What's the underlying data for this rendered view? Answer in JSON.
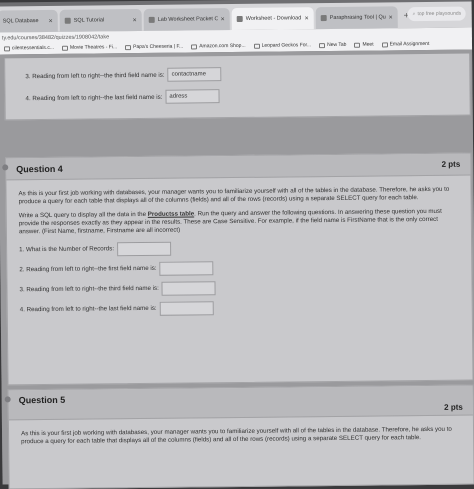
{
  "browser": {
    "tabs": [
      {
        "label": "SQL Database",
        "active": false
      },
      {
        "label": "SQL Tutorial",
        "active": false
      },
      {
        "label": "Lab Worksheet Packet Cap",
        "active": false
      },
      {
        "label": "Worksheet - Download",
        "active": true
      },
      {
        "label": "Paraphrasing Tool | Quilli",
        "active": false
      }
    ],
    "new_tab_symbol": "+",
    "search_text": "top free playsounds",
    "address": "ty.edu/courses/38482/quizzes/1908042/take",
    "bookmarks": [
      "cilentessentials.c...",
      "Movie Theatres - Fi...",
      "Papa's Cheeseria | F...",
      "Amazon.com Shop...",
      "Leopard Geckos For...",
      "New Tab",
      "Meet",
      "Email Assignment"
    ]
  },
  "previous_question": {
    "items": [
      {
        "label": "3. Reading from left to right--the third field name is:",
        "value": "contactname"
      },
      {
        "label": "4. Reading from left to right--the last field name is:",
        "value": "adress"
      }
    ]
  },
  "question4": {
    "title": "Question 4",
    "points": "2 pts",
    "para1": "As this is your first job working with databases, your manager wants you to familiarize yourself with all of the tables in the database.  Therefore, he asks you to produce a query for each table that displays all of the columns (fields) and all of the rows (records) using a separate SELECT query for each table.",
    "para2_before": "Write a SQL query to display all the data in the ",
    "para2_table": "Productss table",
    "para2_after": ". Run the query and answer the following questions. In answering these question you must provide the responses exactly as they appear in the results.  These are Case Sensitive.  For example, if the field name is FirstName that is the only correct answer.  (First Name, firstname, Firstname are all incorrect)",
    "items": [
      {
        "label": "1. What is the Number of Records:",
        "value": ""
      },
      {
        "label": "2. Reading from left to right--the first field name is:",
        "value": ""
      },
      {
        "label": "3. Reading from left to right--the third field name is:",
        "value": ""
      },
      {
        "label": "4. Reading from left to right--the last field name is:",
        "value": ""
      }
    ]
  },
  "question5": {
    "title": "Question 5",
    "points": "2 pts",
    "para1": "As this is your first job working with databases, your manager wants you to familiarize yourself with all of the tables in the database.  Therefore, he asks you to produce a query for each table that displays all of the columns (fields) and all of the rows (records) using a separate SELECT query for each table."
  }
}
